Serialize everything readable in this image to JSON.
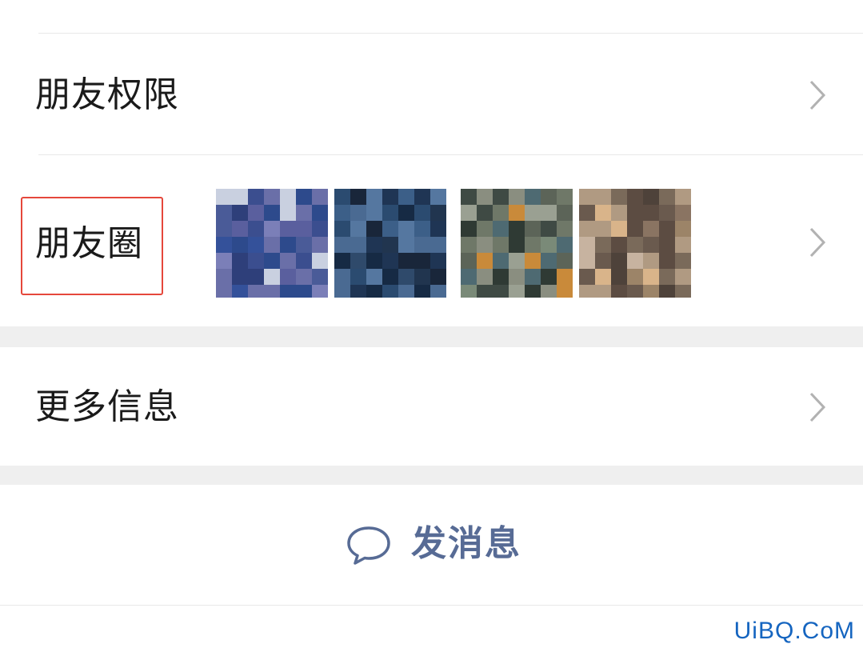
{
  "rows": {
    "friend_permissions": {
      "label": "朋友权限"
    },
    "moments": {
      "label": "朋友圈",
      "thumbnails": [
        {
          "name": "moments-thumbnail-1",
          "palette": [
            "#3b4e8f",
            "#2d4a8c",
            "#5a5f9e",
            "#6a6fa8",
            "#4a5b98",
            "#2e3f7a",
            "#7b7fb8",
            "#34519a",
            "#c9d0e0"
          ]
        },
        {
          "name": "moments-thumbnail-2",
          "palette": [
            "#1f3554",
            "#2b4b70",
            "#3c5f88",
            "#162a44",
            "#4a6a92",
            "#21354f",
            "#5577a0",
            "#19263a",
            "#2f4a6b"
          ]
        },
        {
          "name": "moments-thumbnail-3",
          "palette": [
            "#5c6458",
            "#6f7868",
            "#c98a3a",
            "#3f4a44",
            "#7a8a78",
            "#4e6a72",
            "#8a8e80",
            "#2f3a34",
            "#9aa092"
          ]
        },
        {
          "name": "moments-thumbnail-4",
          "palette": [
            "#7a6a5a",
            "#9c8468",
            "#d9b48a",
            "#5c4c42",
            "#8a7462",
            "#b09a82",
            "#6a5a4e",
            "#c7b3a0",
            "#4e423a"
          ]
        }
      ]
    },
    "more_info": {
      "label": "更多信息"
    }
  },
  "actions": {
    "send_message": {
      "label": "发消息",
      "color": "#576b95"
    }
  },
  "highlight": {
    "color": "#e5473b"
  },
  "watermark": {
    "text": "UiBQ.CoM"
  }
}
